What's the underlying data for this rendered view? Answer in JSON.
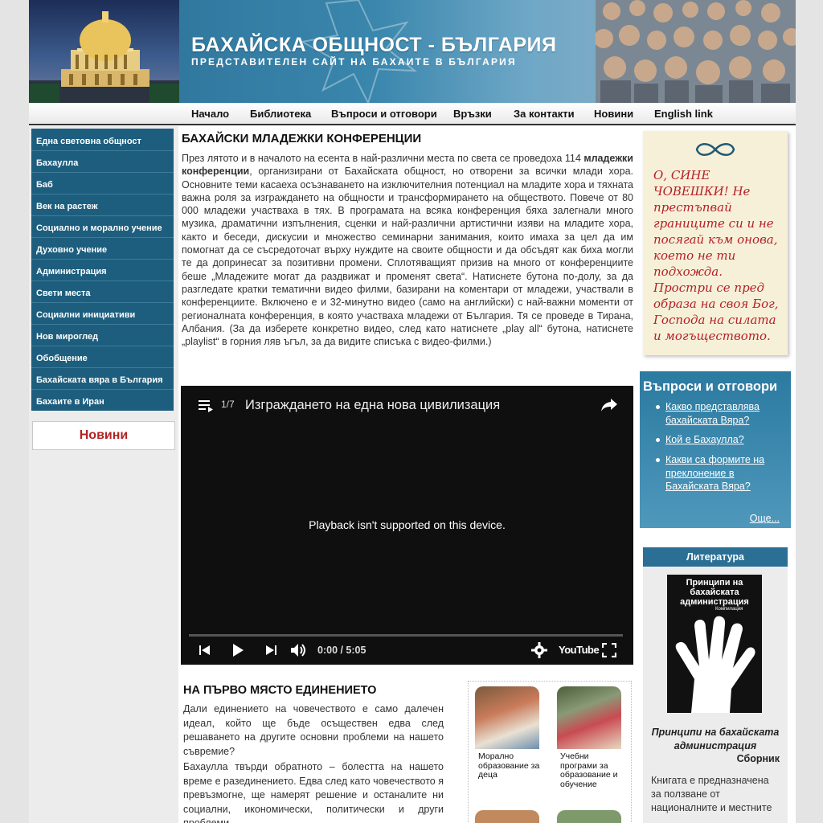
{
  "header": {
    "title": "БАХАЙСКА ОБЩНОСТ - БЪЛГАРИЯ",
    "subtitle": "ПРЕДСТАВИТЕЛЕН САЙТ НА БАХАИТЕ В БЪЛГАРИЯ"
  },
  "nav": [
    "Начало",
    "Библиотека",
    "Въпроси и отговори",
    "Връзки",
    "За контакти",
    "Новини",
    "English link"
  ],
  "sidebar": {
    "items": [
      "Една световна общност",
      "Бахаулла",
      "Баб",
      "Век на растеж",
      "Социално и морално учение",
      "Духовно учение",
      "Администрация",
      "Свети места",
      "Социални инициативи",
      "Нов мироглед",
      "Обобщение",
      "Бахайската вяра в България",
      "Бахаите в Иран"
    ],
    "news_label": "Новини"
  },
  "main": {
    "title": "БАХАЙСКИ МЛАДЕЖКИ КОНФЕРЕНЦИИ",
    "intro_pre": "През лятото и в началото на есента в най-различни места по света се проведоха 114 ",
    "intro_bold": "младежки конференции",
    "intro_post": ", организирани от Бахайската общност, но отворени за всички млади хора. Основните теми касаеха осъзнаването на изключителния потенциал на младите хора и тяхната важна роля за изграждането на общности и трансформирането на обществото. Повече от 80 000 младежи участваха в тях. В програмата на всяка конференция бяха залегнали много музика, драматични изпълнения, сценки и най-различни артистични изяви на младите хора, както и беседи, дискусии и множество семинарни занимания, които имаха за цел да им помогнат да се съсредоточат върху нуждите на своите общности и да обсъдят как биха могли те да допринесат за позитивни промени. Сплотяващият призив на много от конференциите беше „Младежите могат да раздвижат и променят света“. Натиснете бутона по-долу, за да разгледате кратки тематични видео филми, базирани на коментари от младежи, участвали в конференциите. Включено е и 32-минутно видео (само на английски) с най-важни моменти от регионалната конференция, в която участваха младежи от България. Тя се проведе в Тирана, Албания. (За да изберете конкретно видео, след като натиснете „play all“ бутона, натиснете „playlist“ в горния ляв ъгъл, за да видите списъка с видео-филми.)",
    "video": {
      "count": "1/7",
      "title": "Изграждането на една нова цивилизация",
      "message": "Playback isn't supported on this device.",
      "time": "0:00 / 5:05",
      "brand": "YouTube"
    },
    "section2_title": "НА ПЪРВО МЯСТО ЕДИНЕНИЕТО",
    "section2_p1": "Дали единението на човечеството е само далечен идеал, който ще бъде осъществен едва след решаването на другите основни проблеми на нашето съвремие?",
    "section2_p2": "Бахаулла твърди обратното – болестта на нашето време е разединението. Едва след като човечеството я превъзмогне, ще намерят решение и останалите ни социални, икономически, политически и други проблеми.",
    "thumbs": [
      {
        "caption": "Морално образование за деца"
      },
      {
        "caption": "Учебни програми за образование и обучение"
      }
    ]
  },
  "right": {
    "quote": "О, СИНЕ ЧОВЕШКИ! Не престъпвай границите си и не посягай към онова, което не ти подхожда. Простри се пред образа на своя Бог, Господа на силата и могъществото.",
    "qa_title": "Въпроси и отговори",
    "qa_items": [
      "Какво представлява бахайската Вяра?",
      "Кой е Бахаулла?",
      "Какви са формите на преклонение в Бахайската Вяра?"
    ],
    "qa_more": "Още...",
    "lit_title": "Литература",
    "book_cover_title": "Принципи на бахайската администрация",
    "book_cover_sub": "Компилация",
    "book_title": "Принципи на бахайската администрация",
    "book_author": "Сборник",
    "book_desc": "Книгата е предназначена за ползване от националните и местните"
  },
  "colors": {
    "menu_bg": "#1d5e7e",
    "accent_blue": "#2b7aa0",
    "news_red": "#b22222",
    "quote_red": "#b41f2a",
    "quote_bg": "#f7f0d8"
  }
}
